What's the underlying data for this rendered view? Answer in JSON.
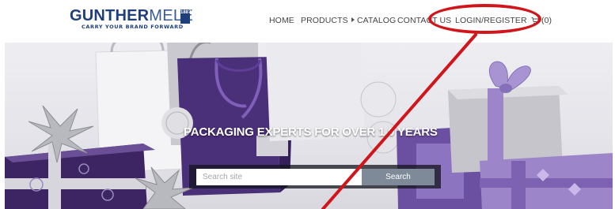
{
  "header": {
    "logo": {
      "brand_bold": "GUNTHER",
      "brand_light": "MELE",
      "est_label": "1887",
      "tagline": "CARRY YOUR BRAND FORWARD"
    },
    "nav": {
      "home": "HOME",
      "products": "PRODUCTS",
      "catalog": "CATALOG",
      "contact": "CONTACT US",
      "login": "LOGIN/REGISTER",
      "cart_count": "(0)"
    }
  },
  "hero": {
    "tagline": "PACKAGING EXPERTS FOR OVER 1 0 YEARS",
    "search": {
      "placeholder": "Search site",
      "button_label": "Search"
    }
  },
  "annotation": {
    "color": "#d0151b",
    "target": "login-register"
  },
  "colors": {
    "brand_navy": "#1f3f7a",
    "purple": "#5b3d8a",
    "lavender": "#9d85c9",
    "search_button": "#7e8a98"
  }
}
